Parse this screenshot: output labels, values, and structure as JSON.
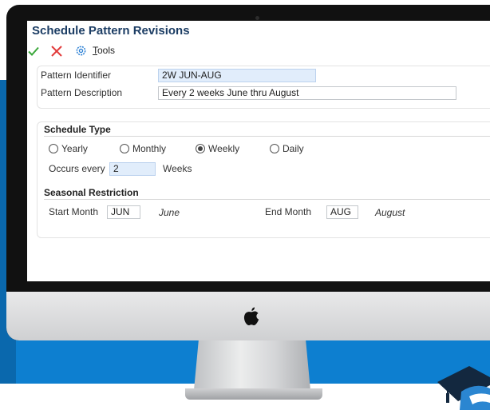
{
  "window": {
    "title": "Schedule Pattern Revisions"
  },
  "toolbar": {
    "tools_label": "Tools",
    "tools_mnemonic": "T",
    "tools_rest": "ools"
  },
  "pattern": {
    "identifier_label": "Pattern Identifier",
    "identifier_value": "2W JUN-AUG",
    "description_label": "Pattern Description",
    "description_value": "Every 2 weeks June thru August"
  },
  "schedule_type": {
    "heading": "Schedule Type",
    "options": [
      {
        "label": "Yearly",
        "checked": false
      },
      {
        "label": "Monthly",
        "checked": false
      },
      {
        "label": "Weekly",
        "checked": true
      },
      {
        "label": "Daily",
        "checked": false
      }
    ],
    "occurs_label": "Occurs every",
    "occurs_value": "2",
    "occurs_unit": "Weeks"
  },
  "seasonal_restriction": {
    "heading": "Seasonal Restriction",
    "start_label": "Start Month",
    "start_value": "JUN",
    "start_name": "June",
    "end_label": "End Month",
    "end_value": "AUG",
    "end_name": "August"
  },
  "colors": {
    "accent_blue": "#0d7fd0",
    "title_navy": "#1c3d64",
    "field_highlight": "#e1edfb",
    "ok_green": "#3aa73a",
    "cancel_red": "#e23b3b",
    "gear_blue": "#2a7fd4"
  },
  "icons": {
    "ok": "checkmark-icon",
    "cancel": "close-icon",
    "tools": "gear-icon",
    "monitor_brand": "apple-logo-icon",
    "corner_logo": "graduation-cap-logo-icon"
  }
}
